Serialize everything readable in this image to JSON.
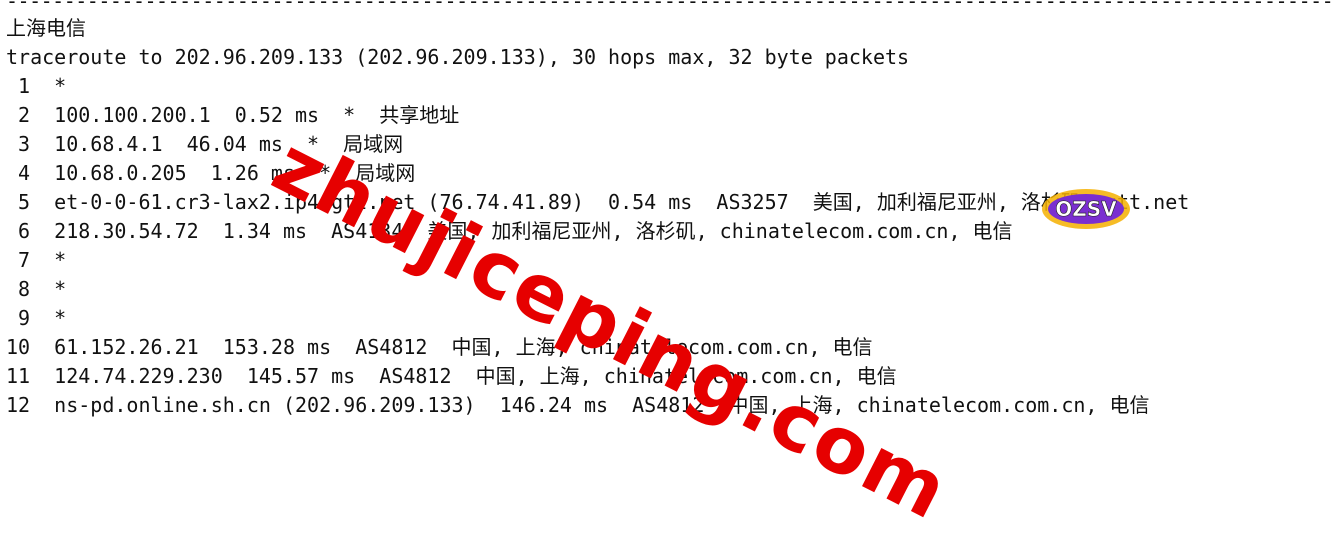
{
  "separator": "--------------------------------------------------------------------------------------------------------------------",
  "region_title": "上海电信",
  "traceroute_header": "traceroute to 202.96.209.133 (202.96.209.133), 30 hops max, 32 byte packets",
  "hops": [
    " 1  *",
    " 2  100.100.200.1  0.52 ms  *  共享地址",
    " 3  10.68.4.1  46.04 ms  *  局域网",
    " 4  10.68.0.205  1.26 ms  *  局域网",
    " 5  et-0-0-61.cr3-lax2.ip4.gtt.net (76.74.41.89)  0.54 ms  AS3257  美国, 加利福尼亚州, 洛杉矶, gtt.net",
    " 6  218.30.54.72  1.34 ms  AS4134  美国, 加利福尼亚州, 洛杉矶, chinatelecom.com.cn, 电信",
    " 7  *",
    " 8  *",
    " 9  *",
    "10  61.152.26.21  153.28 ms  AS4812  中国, 上海, chinatelecom.com.cn, 电信",
    "11  124.74.229.230  145.57 ms  AS4812  中国, 上海, chinatelecom.com.cn, 电信",
    "12  ns-pd.online.sh.cn (202.96.209.133)  146.24 ms  AS4812  中国, 上海, chinatelecom.com.cn, 电信"
  ],
  "watermark_text": "zhujiceping.com",
  "logo_text": "OZSV",
  "colors": {
    "watermark": "#e60000",
    "text": "#111111",
    "background": "#ffffff"
  }
}
